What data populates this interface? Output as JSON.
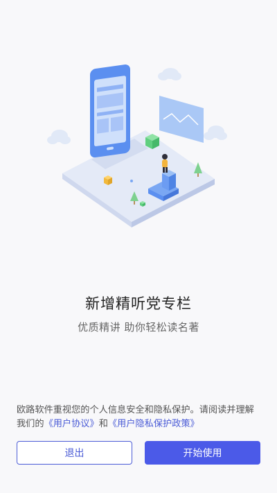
{
  "feature": {
    "title": "新增精听党专栏",
    "subtitle": "优质精讲 助你轻松读名著"
  },
  "privacy": {
    "text_before": "欧路软件重视您的个人信息安全和隐私保护。请阅读并理解我们的",
    "user_agreement_link": "《用户协议》",
    "connector": "和",
    "privacy_policy_link": "《用户隐私保护政策》"
  },
  "buttons": {
    "exit_label": "退出",
    "start_label": "开始使用"
  },
  "colors": {
    "accent": "#4b5ae8",
    "background": "#f8f8fa"
  }
}
